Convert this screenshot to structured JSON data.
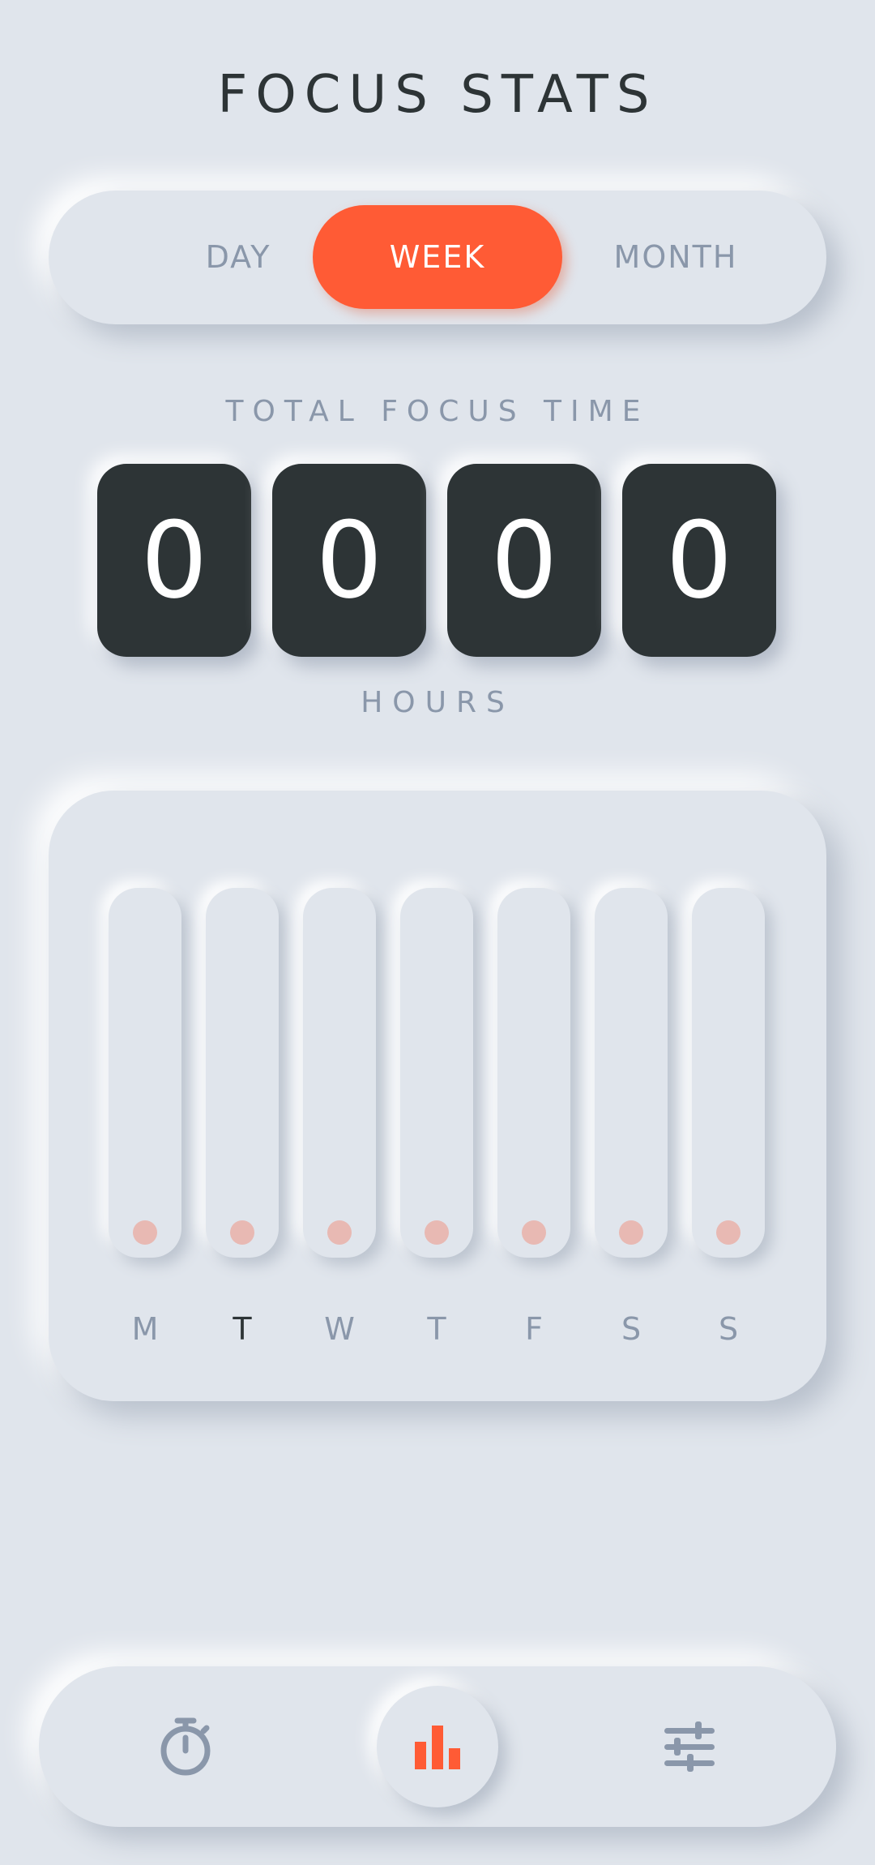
{
  "header": {
    "title": "FOCUS STATS"
  },
  "segments": {
    "day": "DAY",
    "week": "WEEK",
    "month": "MONTH",
    "selected": "WEEK"
  },
  "summary": {
    "label": "TOTAL FOCUS TIME",
    "digits": [
      "0",
      "0",
      "0",
      "0"
    ],
    "unit": "HOURS"
  },
  "chart_data": {
    "type": "bar",
    "categories": [
      "M",
      "T",
      "W",
      "T",
      "F",
      "S",
      "S"
    ],
    "values": [
      0,
      0,
      0,
      0,
      0,
      0,
      0
    ],
    "highlighted_category_index": 1,
    "accent_color": "#ff5b35"
  },
  "nav": {
    "items": [
      {
        "icon": "timer-icon",
        "active": false
      },
      {
        "icon": "bar-chart-icon",
        "active": true
      },
      {
        "icon": "sliders-icon",
        "active": false
      }
    ]
  },
  "colors": {
    "background": "#e0e5ec",
    "accent": "#ff5b35",
    "dark": "#2d3436",
    "muted": "#8a97aa"
  }
}
